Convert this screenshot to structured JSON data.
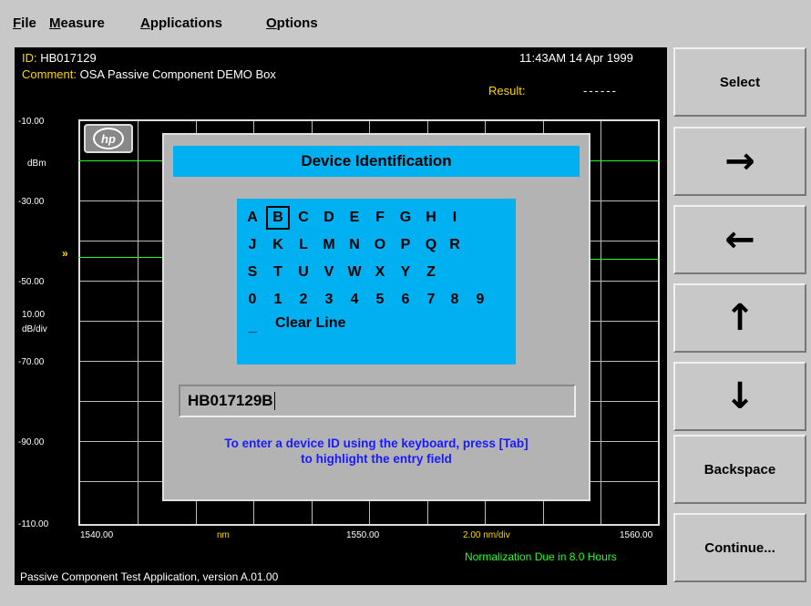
{
  "menubar": {
    "file": {
      "u": "F",
      "rest": "ile"
    },
    "measure": {
      "u": "M",
      "rest": "easure"
    },
    "applications": {
      "pre": "",
      "u": "A",
      "rest": "pplications"
    },
    "options": {
      "u": "O",
      "rest": "ptions"
    }
  },
  "header": {
    "id_label": "ID:",
    "id_value": "HB017129",
    "datetime": "11:43AM 14 Apr 1999",
    "comment_label": "Comment:",
    "comment_value": "OSA Passive Component DEMO Box",
    "result_label": "Result:",
    "result_value": "------"
  },
  "plot": {
    "y_ticks": [
      "-10.00",
      "-30.00",
      "-50.00",
      "-70.00",
      "-90.00",
      "-110.00"
    ],
    "y_unit": "dBm",
    "scale_value": "10.00",
    "scale_unit": "dB/div",
    "x_start": "1540.00",
    "x_unit": "nm",
    "x_center": "1550.00",
    "x_scale": "2.00 nm/div",
    "x_end": "1560.00",
    "logo": "hp",
    "colors": {
      "trace": "#22ff22",
      "grid": "#bbbbbb",
      "labels": "#ffd700"
    }
  },
  "dialog": {
    "title": "Device Identification",
    "rows": [
      [
        "A",
        "B",
        "C",
        "D",
        "E",
        "F",
        "G",
        "H",
        "I"
      ],
      [
        "J",
        "K",
        "L",
        "M",
        "N",
        "O",
        "P",
        "Q",
        "R"
      ],
      [
        "S",
        "T",
        "U",
        "V",
        "W",
        "X",
        "Y",
        "Z"
      ],
      [
        "0",
        "1",
        "2",
        "3",
        "4",
        "5",
        "6",
        "7",
        "8",
        "9"
      ]
    ],
    "selected": "B",
    "underscore": "_",
    "clear_line": "Clear Line",
    "entry_value": "HB017129B",
    "help_line1": "To enter a device ID using the keyboard, press [Tab]",
    "help_line2": "to highlight the entry field",
    "colors": {
      "panel": "#00b0f0",
      "help_text": "#1a1aff"
    }
  },
  "softkeys": {
    "select": "Select",
    "right": "→",
    "left": "←",
    "up": "↑",
    "down": "↓",
    "backspace": "Backspace",
    "continue": "Continue..."
  },
  "status": {
    "normalization": "Normalization Due in  8.0 Hours",
    "footer": "Passive Component Test Application, version A.01.00"
  }
}
